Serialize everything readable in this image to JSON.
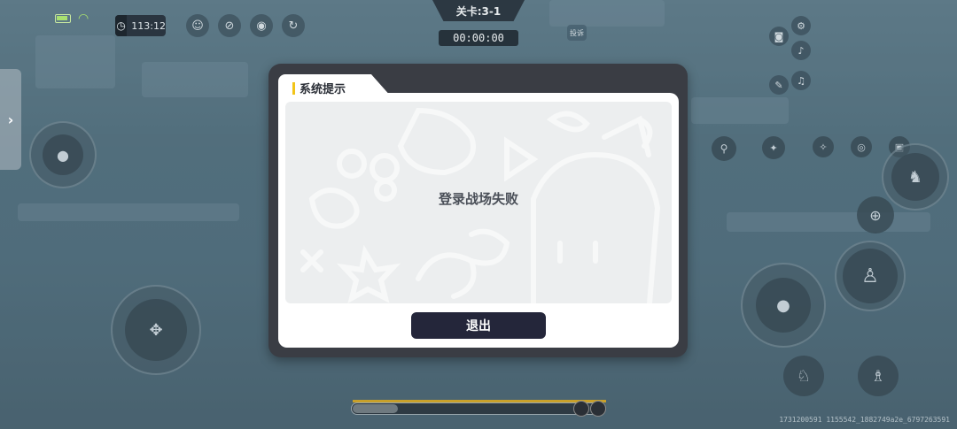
{
  "status": {
    "game_clock": "113:12"
  },
  "top": {
    "level_label": "关卡:3-1",
    "match_timer": "00:00:00",
    "report_label": "投诉"
  },
  "dialog": {
    "title": "系统提示",
    "message": "登录战场失败",
    "exit_label": "退出"
  },
  "side_tab": {
    "arrow": "›"
  },
  "progress": {
    "value": 0.18
  },
  "footer": {
    "info": "1731200591 1155542_1882749a2e_6797263591"
  },
  "icons": {
    "top_left": [
      "emoji-chat-icon",
      "mute-icon",
      "ghost-icon",
      "refresh-icon"
    ],
    "top_right": [
      "settings-icon",
      "camera-icon",
      "speaker-icon",
      "edit-icon",
      "mic-icon"
    ],
    "actions": [
      "map-marker-icon",
      "skill-icon",
      "grenade-icon",
      "skill-2-icon",
      "item-icon"
    ]
  },
  "colors": {
    "dialog_frame": "#3a3d44",
    "exit_button": "#24263a",
    "title_accent": "#f2c418"
  }
}
